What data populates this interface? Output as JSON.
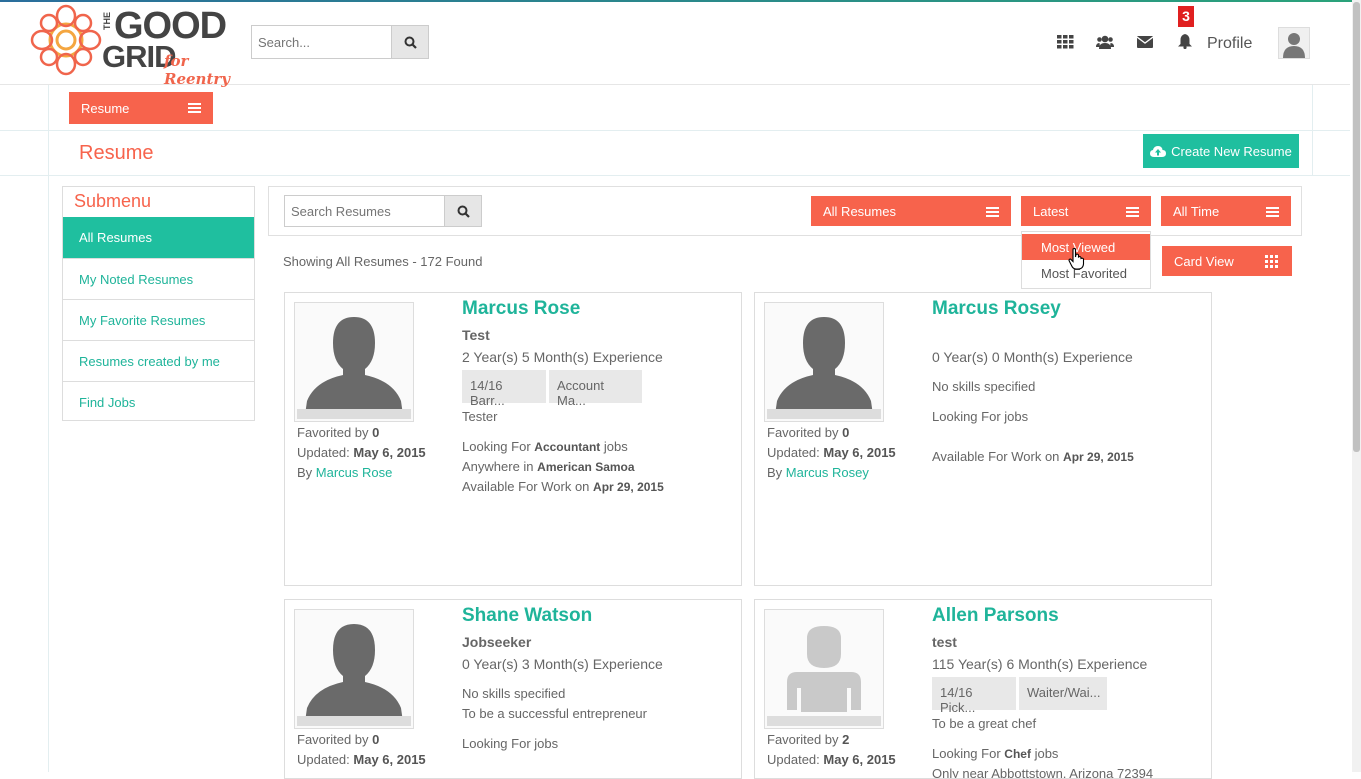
{
  "header": {
    "logo_alt": "The Good Grid for Reentry",
    "logo_the": "THE",
    "logo_good": "GOOD",
    "logo_grid": "GRID",
    "logo_reentry": "for Reentry",
    "search_placeholder": "Search...",
    "notification_count": "3",
    "profile_label": "Profile"
  },
  "toolbar": {
    "section_dropdown": "Resume",
    "page_title": "Resume",
    "create_button": "Create New Resume"
  },
  "submenu": {
    "title": "Submenu",
    "items": [
      "All Resumes",
      "My Noted Resumes",
      "My Favorite Resumes",
      "Resumes created by me",
      "Find Jobs"
    ]
  },
  "filters": {
    "search_placeholder": "Search Resumes",
    "scope": "All Resumes",
    "sort": "Latest",
    "period": "All Time",
    "view": "Card View",
    "sort_options": [
      "Most Viewed",
      "Most Favorited"
    ]
  },
  "results": {
    "summary": "Showing All Resumes - 172 Found"
  },
  "cards": [
    {
      "name": "Marcus Rose",
      "title": "Test",
      "experience": "2 Year(s) 5 Month(s) Experience",
      "tags": [
        "14/16 Barr...",
        "Account Ma..."
      ],
      "skills_text": "Tester",
      "looking_prefix": "Looking For",
      "looking_job": "Accountant",
      "looking_suffix": "jobs",
      "location_prefix": "Anywhere in",
      "location": "American Samoa",
      "available_prefix": "Available For Work on",
      "available_date": "Apr 29, 2015",
      "favorited_label": "Favorited by",
      "favorited_count": "0",
      "updated_label": "Updated:",
      "updated_date": "May 6, 2015",
      "by_label": "By",
      "by_name": "Marcus Rose"
    },
    {
      "name": "Marcus Rosey",
      "experience": "0 Year(s) 0 Month(s) Experience",
      "skills_text": "No skills specified",
      "looking_text": "Looking For jobs",
      "available_prefix": "Available For Work on",
      "available_date": "Apr 29, 2015",
      "favorited_label": "Favorited by",
      "favorited_count": "0",
      "updated_label": "Updated:",
      "updated_date": "May 6, 2015",
      "by_label": "By",
      "by_name": "Marcus Rosey"
    },
    {
      "name": "Shane Watson",
      "title": "Jobseeker",
      "experience": "0 Year(s) 3 Month(s) Experience",
      "skills_text": "No skills specified",
      "objective": "To be a successful entrepreneur",
      "looking_text": "Looking For jobs",
      "favorited_label": "Favorited by",
      "favorited_count": "0",
      "updated_label": "Updated:",
      "updated_date": "May 6, 2015"
    },
    {
      "name": "Allen Parsons",
      "title": "test",
      "experience": "115 Year(s) 6 Month(s) Experience",
      "tags": [
        "14/16 Pick...",
        "Waiter/Wai..."
      ],
      "objective": "To be a great chef",
      "looking_prefix": "Looking For",
      "looking_job": "Chef",
      "looking_suffix": "jobs",
      "location_partial": "Only near Abbottstown, Arizona 72394",
      "favorited_label": "Favorited by",
      "favorited_count": "2",
      "updated_label": "Updated:",
      "updated_date": "May 6, 2015"
    }
  ],
  "colors": {
    "accent_orange": "#f7634c",
    "accent_teal": "#1fbf9f",
    "badge_red": "#e02020"
  }
}
